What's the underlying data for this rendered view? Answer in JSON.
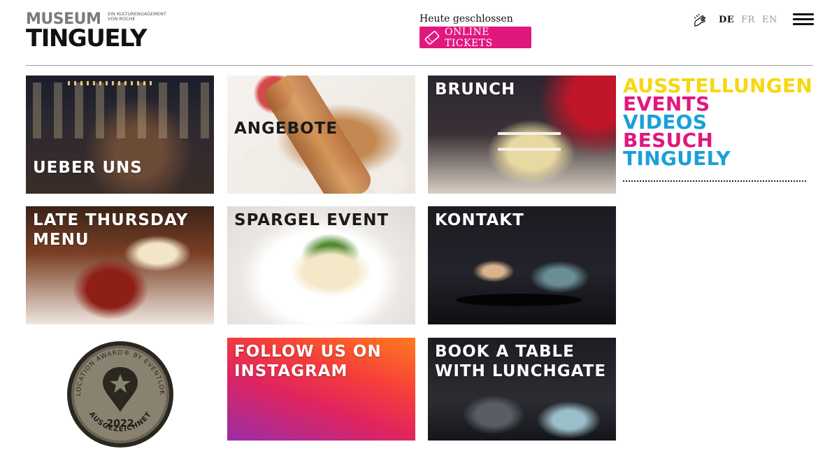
{
  "logo": {
    "line1": "MUSEUM",
    "tagline": "EIN KULTURENGAGEMENT VON ROCHE",
    "line2": "TINGUELY"
  },
  "header": {
    "status": "Heute geschlossen",
    "tickets_label": "ONLINE TICKETS",
    "languages": [
      "DE",
      "FR",
      "EN"
    ],
    "active_language": "DE",
    "accent_color": "#e0187e"
  },
  "tiles": [
    {
      "label_line1": "UEBER UNS",
      "label_line2": ""
    },
    {
      "label_line1": "ANGEBOTE",
      "label_line2": ""
    },
    {
      "label_line1": "BRUNCH",
      "label_line2": ""
    },
    {
      "label_line1": "LATE THURSDAY",
      "label_line2": "MENU"
    },
    {
      "label_line1": "SPARGEL EVENT",
      "label_line2": ""
    },
    {
      "label_line1": "KONTAKT",
      "label_line2": ""
    },
    {
      "label_line1": "FOLLOW US ON",
      "label_line2": "INSTAGRAM"
    },
    {
      "label_line1": "BOOK A TABLE",
      "label_line2": "WITH LUNCHGATE"
    }
  ],
  "award": {
    "top_text": "SWISS LOCATION AWARD® BY EVENTLOKALE.CH",
    "year": "2022",
    "bottom_text": "AUSGEZEICHNET"
  },
  "nav": {
    "items": [
      {
        "label": "AUSSTELLUNGEN",
        "color": "#f5d80f"
      },
      {
        "label": "EVENTS",
        "color": "#e0187e"
      },
      {
        "label": "VIDEOS",
        "color": "#1aa0d8"
      },
      {
        "label": "BESUCH",
        "color": "#e0187e"
      },
      {
        "label": "TINGUELY",
        "color": "#1aa0d8"
      }
    ]
  }
}
